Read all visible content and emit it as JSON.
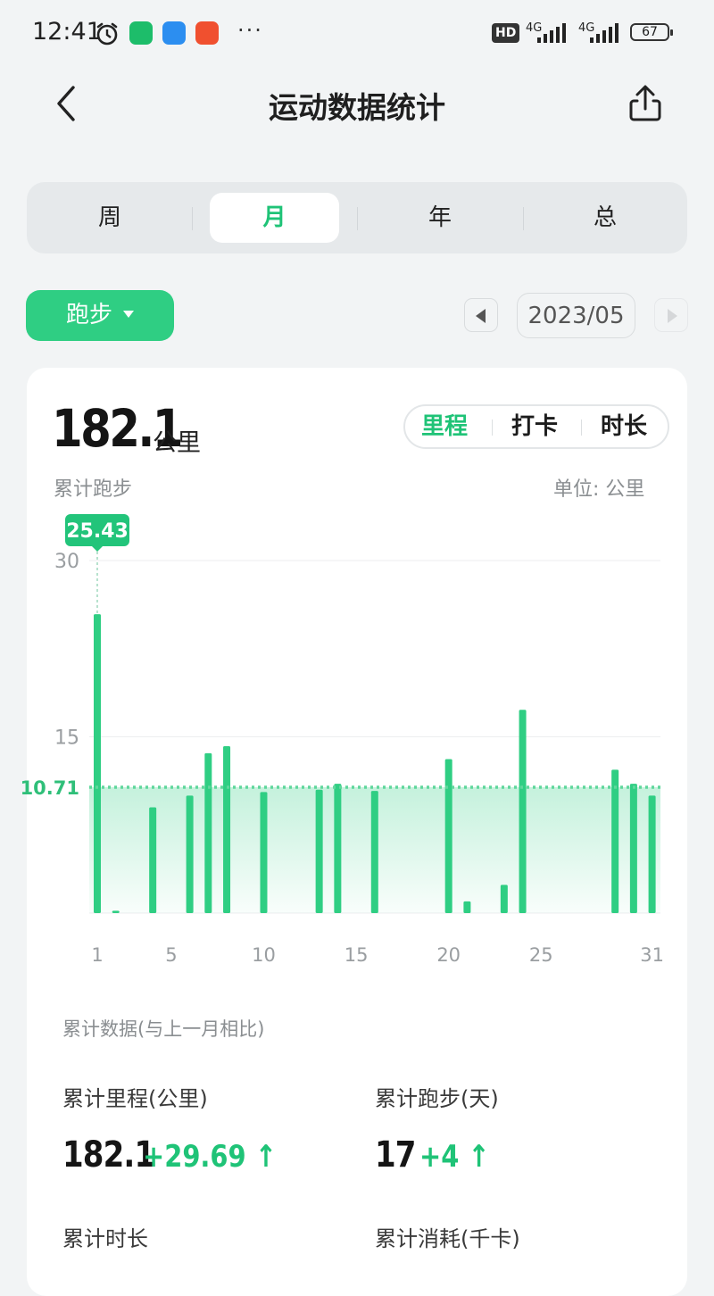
{
  "status_bar": {
    "time": "12:41",
    "network_badge": "HD",
    "signal_1": "4G",
    "signal_2": "4G",
    "battery": "67"
  },
  "header": {
    "title": "运动数据统计",
    "back_icon": "chevron-left-icon",
    "share_icon": "share-icon"
  },
  "period_tabs": [
    {
      "label": "周",
      "active": false
    },
    {
      "label": "月",
      "active": true
    },
    {
      "label": "年",
      "active": false
    },
    {
      "label": "总",
      "active": false
    }
  ],
  "sport_selector": {
    "label": "跑步"
  },
  "month_nav": {
    "current": "2023/05"
  },
  "summary": {
    "total_value": "182.1",
    "total_unit": "公里",
    "sub_label": "累计跑步",
    "unit_label": "单位: 公里",
    "metric_tabs": [
      {
        "label": "里程",
        "active": true
      },
      {
        "label": "打卡",
        "active": false
      },
      {
        "label": "时长",
        "active": false
      }
    ]
  },
  "chart_data": {
    "type": "bar",
    "x": [
      1,
      2,
      4,
      6,
      7,
      8,
      10,
      13,
      14,
      16,
      20,
      21,
      23,
      24,
      29,
      30,
      31
    ],
    "values": [
      25.43,
      0.2,
      9.0,
      10.0,
      13.6,
      14.2,
      10.3,
      10.5,
      11.0,
      10.4,
      13.1,
      1.0,
      2.4,
      17.3,
      12.2,
      11.0,
      10.0
    ],
    "ylim": [
      0,
      30
    ],
    "y_ticks": [
      "30",
      "15"
    ],
    "x_ticks": [
      "1",
      "5",
      "10",
      "15",
      "20",
      "25",
      "31"
    ],
    "x_tick_values": [
      1,
      5,
      10,
      15,
      20,
      25,
      31
    ],
    "average": 10.71,
    "average_label": "10.71",
    "highlight_label": "25.43",
    "highlight_day": 1,
    "color": "#2fce83"
  },
  "stats": {
    "title": "累计数据(与上一月相比)",
    "items": [
      {
        "label": "累计里程(公里)",
        "value": "182.1",
        "delta": "+29.69 ↑"
      },
      {
        "label": "累计跑步(天)",
        "value": "17",
        "delta": "+4 ↑"
      },
      {
        "label": "累计时长",
        "value": "",
        "delta": ""
      },
      {
        "label": "累计消耗(千卡)",
        "value": "",
        "delta": ""
      }
    ]
  }
}
